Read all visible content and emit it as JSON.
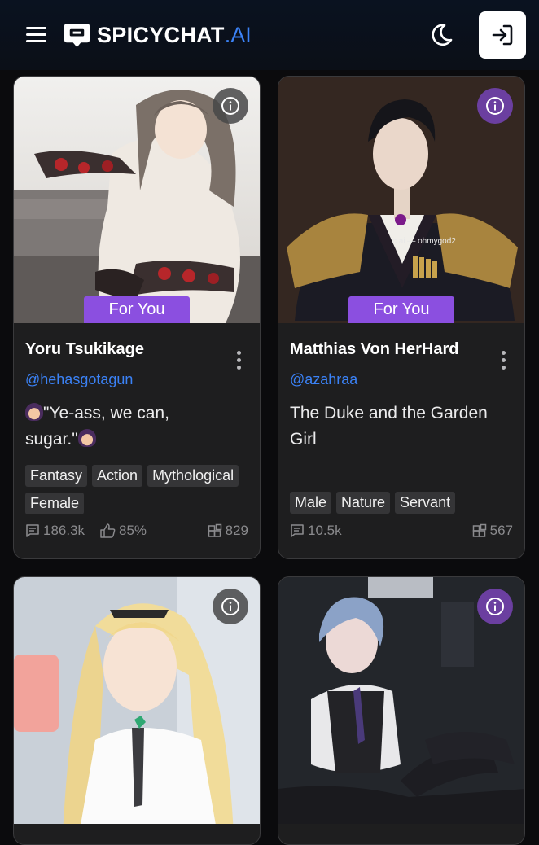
{
  "header": {
    "brand": "SPICYCHAT",
    "brand_suffix": ".AI"
  },
  "cards": [
    {
      "name": "Yoru Tsukikage",
      "creator": "@hehasgotagun",
      "badge": "For You",
      "description_line1": "\"Ye-ass, we can,",
      "description_line2": "sugar.\"",
      "tags": [
        "Fantasy",
        "Action",
        "Mythological",
        "Female"
      ],
      "messages": "186.3k",
      "likes": "85%",
      "bots": "829",
      "info_style": "grey"
    },
    {
      "name": "Matthias Von HerHard",
      "creator": "@azahraa",
      "badge": "For You",
      "description": "The Duke and the Garden Girl",
      "image_watermark": "c.ai — ohmygod2",
      "tags": [
        "Male",
        "Nature",
        "Servant"
      ],
      "messages": "10.5k",
      "bots": "567",
      "info_style": "purple"
    },
    {
      "info_style": "grey"
    },
    {
      "info_style": "purple"
    }
  ]
}
